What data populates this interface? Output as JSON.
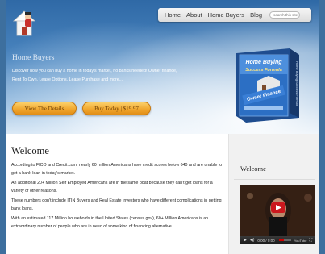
{
  "nav": {
    "items": [
      "Home",
      "About",
      "Home Buyers",
      "Blog"
    ],
    "search_placeholder": "search this site..."
  },
  "hero": {
    "title": "Home Buyers",
    "description": "Discover how you can buy a home in today's market, no banks needed!  Owner finance, Rent To Own, Lease Options, Lease Purchase and more...",
    "btn_details": "View The Details",
    "btn_buy": "Buy Today | $19.97",
    "product": {
      "title_line1": "Home Buying",
      "title_line2": "Success Formula",
      "sticker": "Owner Finance",
      "side_text": "Home Buying Success Formula"
    }
  },
  "main": {
    "title": "Welcome",
    "paragraphs": [
      "According to FICO and Credit.com, nearly 60 million Americans have credit scores below 640 and are unable to get a bank loan in today's market.",
      "An additional 20+ Million Self Employed Americans are in the same boat because they can't get loans for a variety of other reasons.",
      "These numbers don't include ITIN Buyers and Real Estate Investors who have different complications in getting bank loans.",
      "With an estimated 117 Million households in the United States (census.gov), 60+ Million Americans is an extraordinary number of people who are in need of some kind of financing alternative."
    ]
  },
  "sidebar": {
    "title": "Welcome",
    "video": {
      "time": "0:00 / 0:00",
      "progress_fraction": 0.45,
      "brand": "YouTube"
    }
  },
  "colors": {
    "accent_orange": "#f0a52c",
    "sky_blue": "#3d6f9e"
  }
}
